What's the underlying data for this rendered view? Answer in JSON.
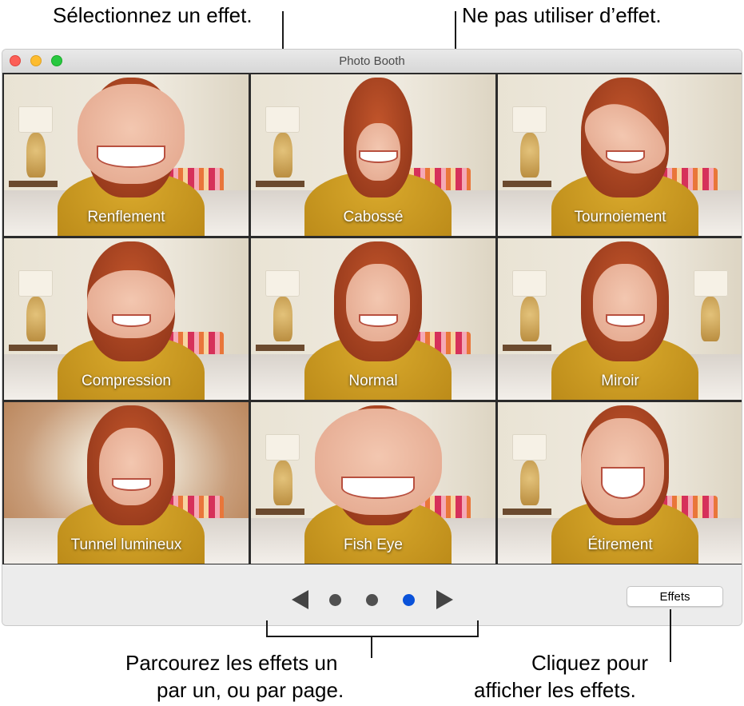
{
  "callouts": {
    "select_effect": "Sélectionnez un effet.",
    "no_effect": "Ne pas utiliser d’effet.",
    "browse_line1": "Parcourez les effets un",
    "browse_line2": "par un, ou par page.",
    "click_line1": "Cliquez pour",
    "click_line2": "afficher les effets."
  },
  "window": {
    "title": "Photo Booth"
  },
  "effects": [
    {
      "label": "Renflement"
    },
    {
      "label": "Cabossé"
    },
    {
      "label": "Tournoiement"
    },
    {
      "label": "Compression"
    },
    {
      "label": "Normal"
    },
    {
      "label": "Miroir"
    },
    {
      "label": "Tunnel lumineux"
    },
    {
      "label": "Fish Eye"
    },
    {
      "label": "Étirement"
    }
  ],
  "pager": {
    "page_count": 3,
    "current_page": 3,
    "active_color": "#0a52d9"
  },
  "toolbar": {
    "effects_button": "Effets"
  }
}
